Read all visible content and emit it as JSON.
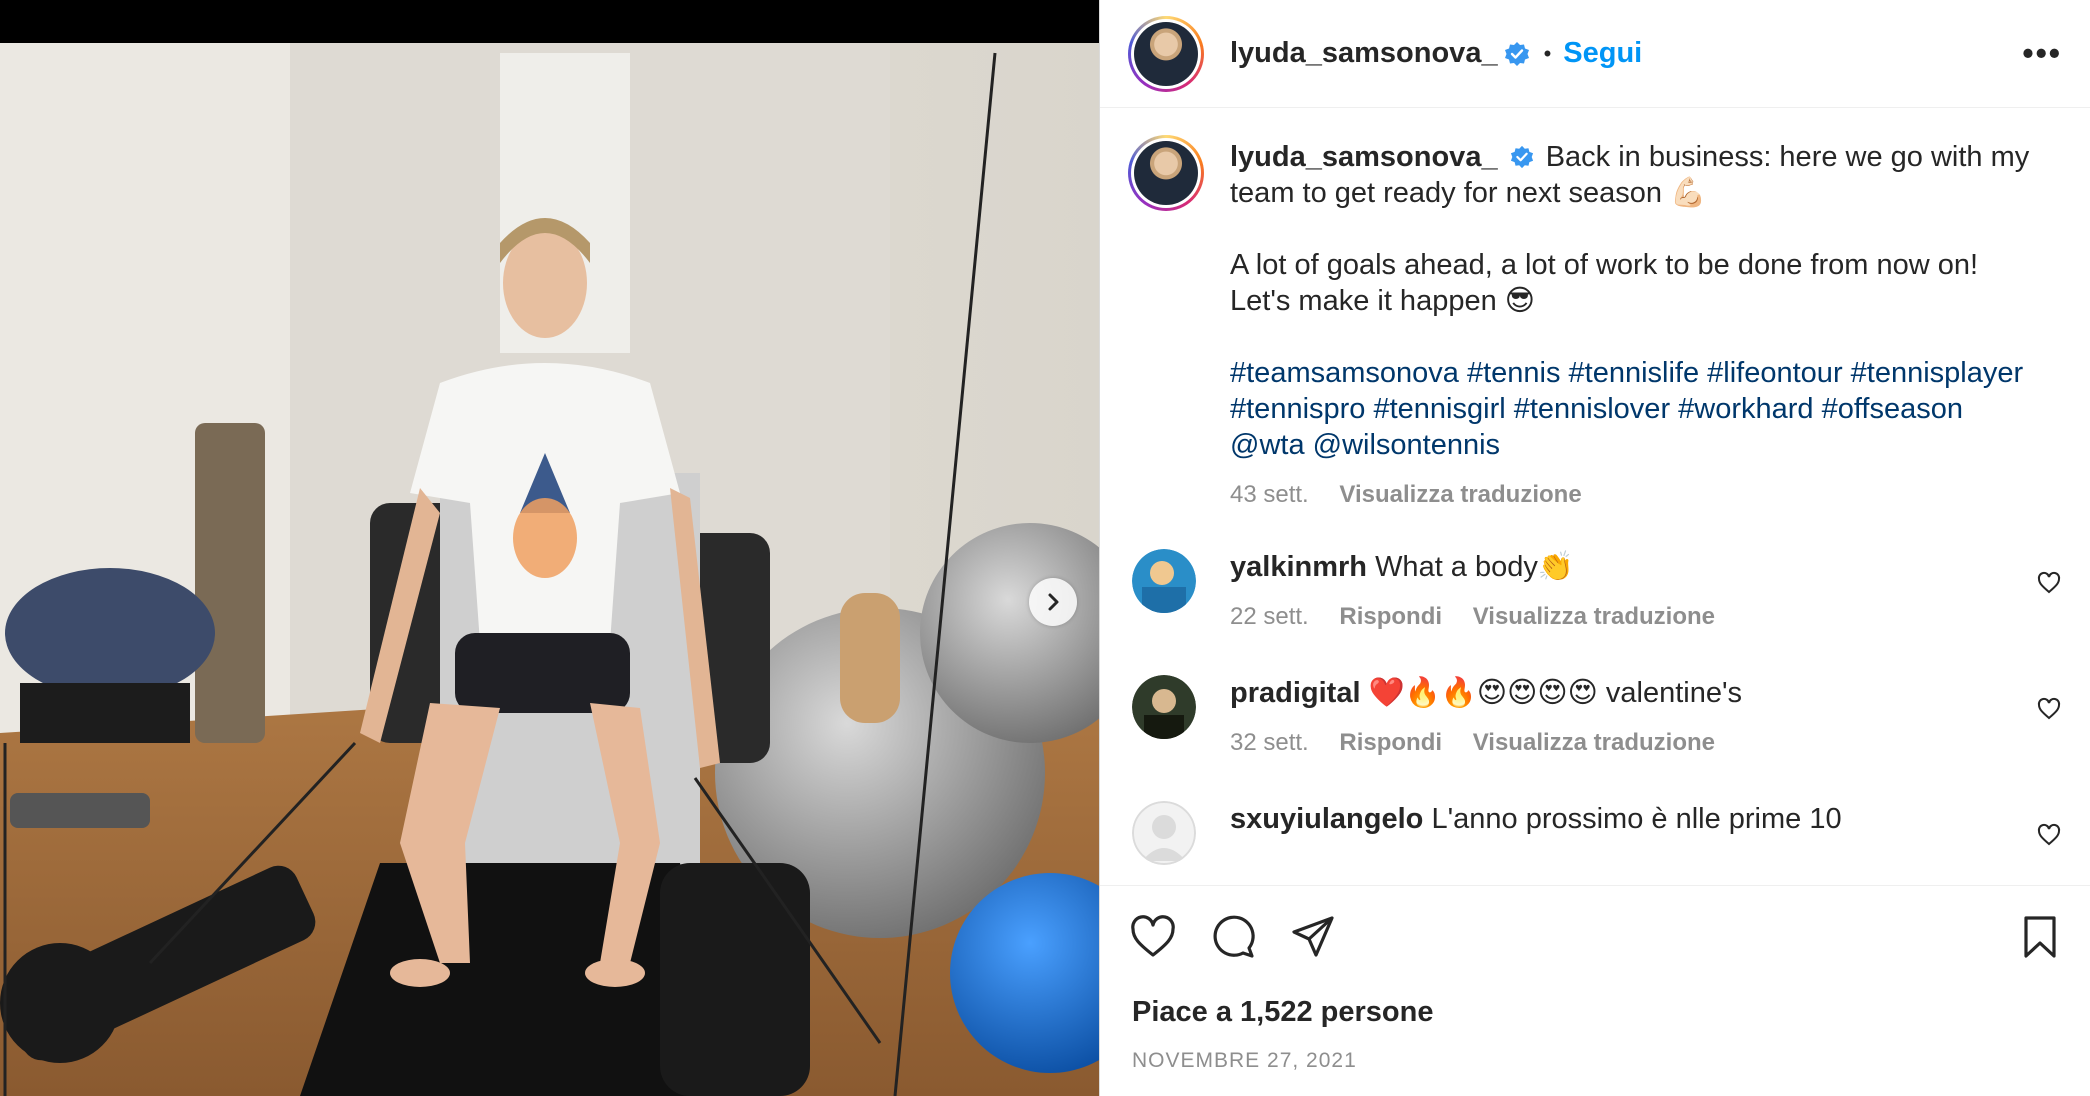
{
  "header": {
    "username": "lyuda_samsonova_",
    "dot": "•",
    "follow_label": "Segui",
    "more_label": "•••"
  },
  "caption": {
    "username": "lyuda_samsonova_",
    "line1": "Back in business: here we go with my team to get ready for next season 💪🏻",
    "line2": "A lot of goals ahead, a lot of work to be done from now on! Let's make it happen 😎",
    "hashtags": "#teamsamsonova #tennis #tennislife #lifeontour #tennisplayer #tennispro #tennisgirl #tennislover #workhard #offseason @wta @wilsontennis",
    "time": "43 sett.",
    "translate": "Visualizza traduzione"
  },
  "comments": [
    {
      "username": "yalkinmrh",
      "text": "What a body👏",
      "time": "22 sett.",
      "reply": "Rispondi",
      "translate": "Visualizza traduzione"
    },
    {
      "username": "pradigital",
      "text": "❤️🔥🔥😍😍😍😍 valentine's",
      "time": "32 sett.",
      "reply": "Rispondi",
      "translate": "Visualizza traduzione"
    },
    {
      "username": "sxuyiulangelo",
      "text": "L'anno prossimo è nlle prime 10"
    }
  ],
  "footer": {
    "likes": "Piace a 1,522 persone",
    "date": "NOVEMBRE 27, 2021"
  },
  "icons": {
    "like": "heart-icon",
    "comment": "comment-icon",
    "share": "share-icon",
    "save": "bookmark-icon",
    "next": "chevron-right-icon",
    "verified": "verified-badge-icon"
  },
  "colors": {
    "link": "#0095f6",
    "hashtag": "#00376b",
    "muted": "#8e8e8e",
    "text": "#262626"
  }
}
